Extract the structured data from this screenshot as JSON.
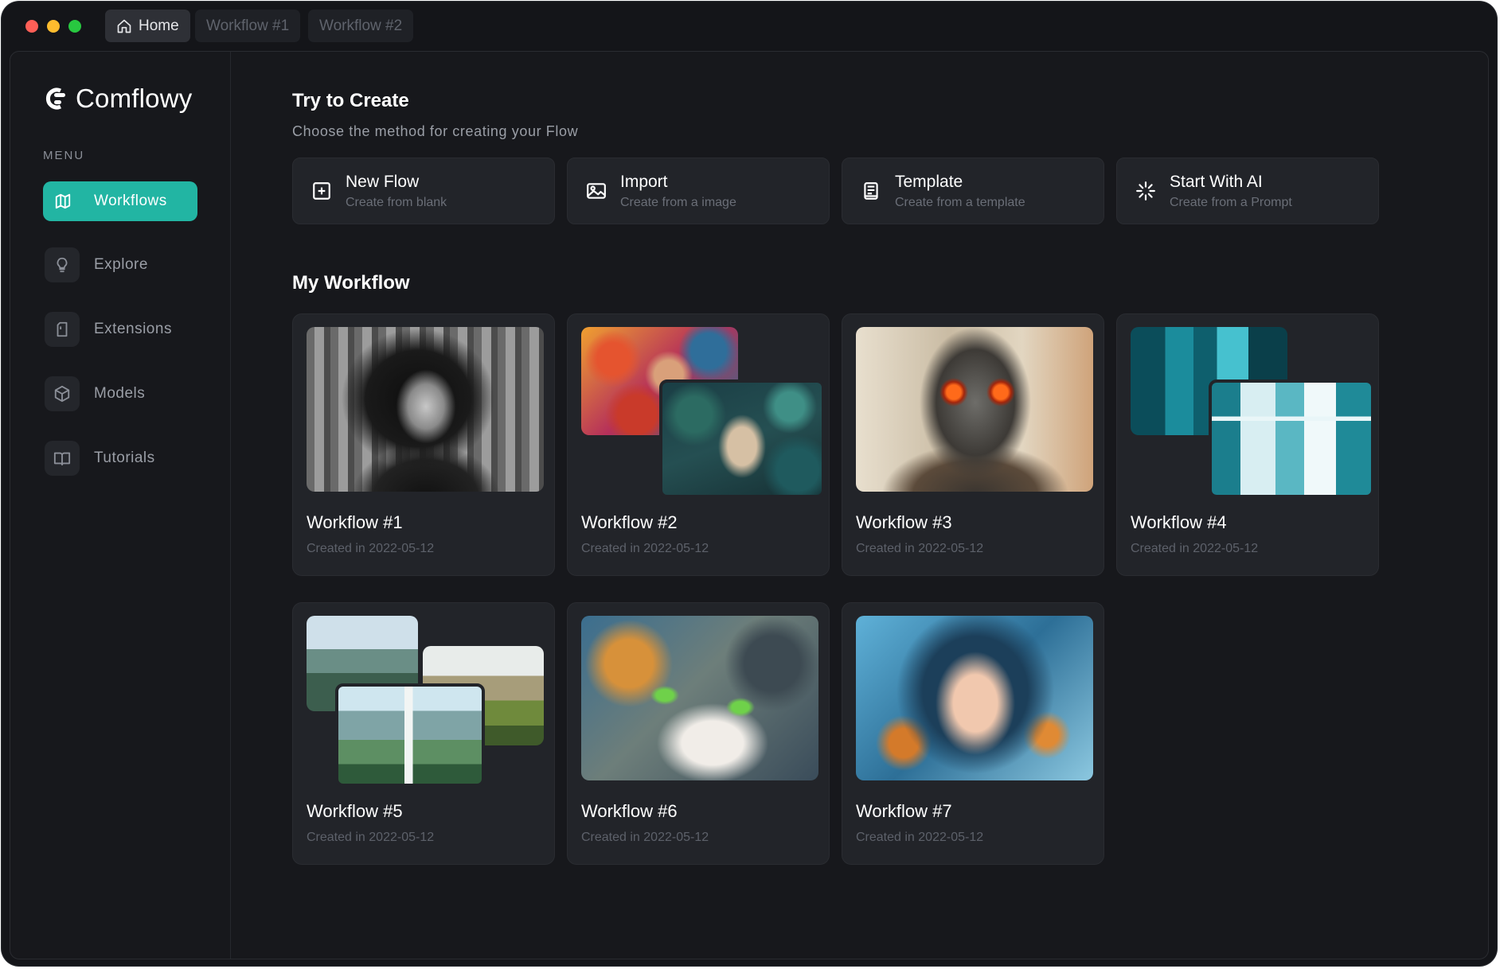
{
  "tabs": [
    {
      "label": "Home",
      "icon": "home-icon",
      "active": true
    },
    {
      "label": "Workflow #1",
      "active": false
    },
    {
      "label": "Workflow #2",
      "active": false
    }
  ],
  "brand": {
    "name": "Comflowy",
    "accent": "#22b5a3"
  },
  "sidebar": {
    "menu_label": "MENU",
    "items": [
      {
        "label": "Workflows",
        "icon": "map-icon",
        "active": true
      },
      {
        "label": "Explore",
        "icon": "lightbulb-icon"
      },
      {
        "label": "Extensions",
        "icon": "extension-icon"
      },
      {
        "label": "Models",
        "icon": "cube-icon"
      },
      {
        "label": "Tutorials",
        "icon": "book-icon"
      }
    ]
  },
  "create": {
    "title": "Try to Create",
    "subtitle": "Choose the method for creating your Flow",
    "options": [
      {
        "title": "New Flow",
        "desc": "Create from blank",
        "icon": "plus-square-icon"
      },
      {
        "title": "Import",
        "desc": "Create from a image",
        "icon": "image-icon"
      },
      {
        "title": "Template",
        "desc": "Create from a template",
        "icon": "template-icon"
      },
      {
        "title": "Start With AI",
        "desc": "Create from a Prompt",
        "icon": "sparkle-icon"
      }
    ]
  },
  "workflows": {
    "title": "My Workflow",
    "items": [
      {
        "name": "Workflow #1",
        "date": "Created in 2022-05-12"
      },
      {
        "name": "Workflow #2",
        "date": "Created in 2022-05-12"
      },
      {
        "name": "Workflow #3",
        "date": "Created in 2022-05-12"
      },
      {
        "name": "Workflow #4",
        "date": "Created in 2022-05-12"
      },
      {
        "name": "Workflow #5",
        "date": "Created in 2022-05-12"
      },
      {
        "name": "Workflow #6",
        "date": "Created in 2022-05-12"
      },
      {
        "name": "Workflow #7",
        "date": "Created in 2022-05-12"
      }
    ]
  }
}
